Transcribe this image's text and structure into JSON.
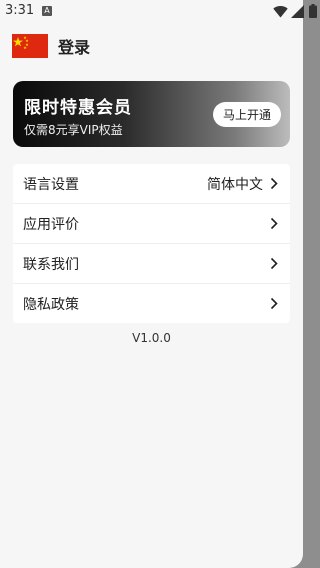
{
  "status_bar": {
    "time": "3:31",
    "notification_icon": "A"
  },
  "header": {
    "flag_icon": "china-flag-icon",
    "title": "登录"
  },
  "vip_card": {
    "title": "限时特惠会员",
    "subtitle": "仅需8元享VIP权益",
    "button_label": "马上开通"
  },
  "menu": {
    "items": [
      {
        "label": "语言设置",
        "value": "简体中文",
        "icon": "chevron-right-icon"
      },
      {
        "label": "应用评价",
        "value": "",
        "icon": "chevron-right-icon"
      },
      {
        "label": "联系我们",
        "value": "",
        "icon": "chevron-right-icon"
      },
      {
        "label": "隐私政策",
        "value": "",
        "icon": "chevron-right-icon"
      }
    ]
  },
  "version": "V1.0.0",
  "colors": {
    "drawer_background": "#f6f6f6",
    "scrim": "#8e8e8e",
    "flag_red": "#de2910",
    "flag_yellow": "#ffde00"
  }
}
